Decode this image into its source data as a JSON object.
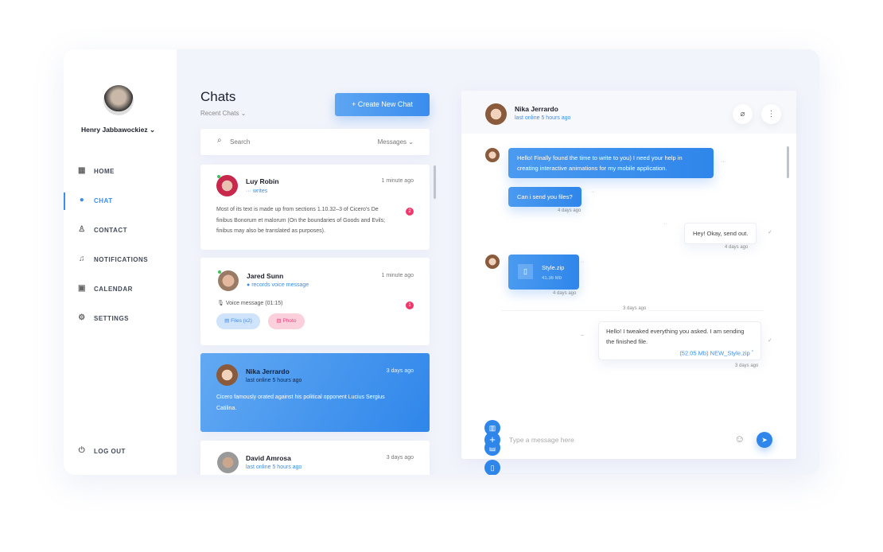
{
  "user": {
    "name": "Henry Jabbawockiez"
  },
  "nav": [
    {
      "label": "HOME",
      "icon": "grid-icon"
    },
    {
      "label": "CHAT",
      "icon": "chat-bubble-icon",
      "active": true
    },
    {
      "label": "CONTACT",
      "icon": "user-icon"
    },
    {
      "label": "NOTIFICATIONS",
      "icon": "bell-icon"
    },
    {
      "label": "CALENDAR",
      "icon": "calendar-icon"
    },
    {
      "label": "SETTINGS",
      "icon": "gear-icon"
    }
  ],
  "logout": "LOG OUT",
  "chats": {
    "title": "Chats",
    "filter": "Recent Chats",
    "create": "Create New Chat",
    "search_placeholder": "Search",
    "search_scope": "Messages",
    "items": [
      {
        "name": "Luy Robin",
        "status": "writes",
        "time": "1 minute ago",
        "text": "Most of its text is made up from sections 1.10.32–3 of Cicero's De finibus Bonorum et malorum (On the boundaries of Goods and Evils; finibus may also be translated as purposes).",
        "unread": "2"
      },
      {
        "name": "Jared Sunn",
        "status": "records voice message",
        "time": "1 minute ago",
        "text": "Voice message (01:15)",
        "unread": "1",
        "chips": [
          "Files (x2)",
          "Photo"
        ]
      },
      {
        "name": "Nika Jerrardo",
        "status": "last online 5 hours ago",
        "time": "3 days ago",
        "text": "Cicero famously orated against his political opponent Lucius Sergius Catilina."
      },
      {
        "name": "David Amrosa",
        "status": "last online 5 hours ago",
        "time": "3 days ago"
      }
    ]
  },
  "conversation": {
    "name": "Nika Jerrardo",
    "status": "last online 5 hours ago",
    "messages": [
      {
        "text": "Hello! Finally found the time to write to you) I need your help in creating interactive animations for my mobile application."
      },
      {
        "text": "Can i send you files?",
        "time": "4 days ago"
      },
      {
        "text": "Hey! Okay, send out.",
        "time": "4 days ago"
      },
      {
        "file": "Style.zip",
        "size": "41.36 Mb",
        "time": "4 days ago"
      },
      {
        "divider": "3 days ago"
      },
      {
        "text": "Hello! I tweaked everything you asked. I am sending the finished file.",
        "link": "(52.05 Mb) NEW_Style.zip",
        "time": "3 days ago"
      }
    ],
    "input_placeholder": "Type a message here"
  },
  "colors": {
    "accent": "#2f86ea",
    "badge": "#f0376a"
  }
}
